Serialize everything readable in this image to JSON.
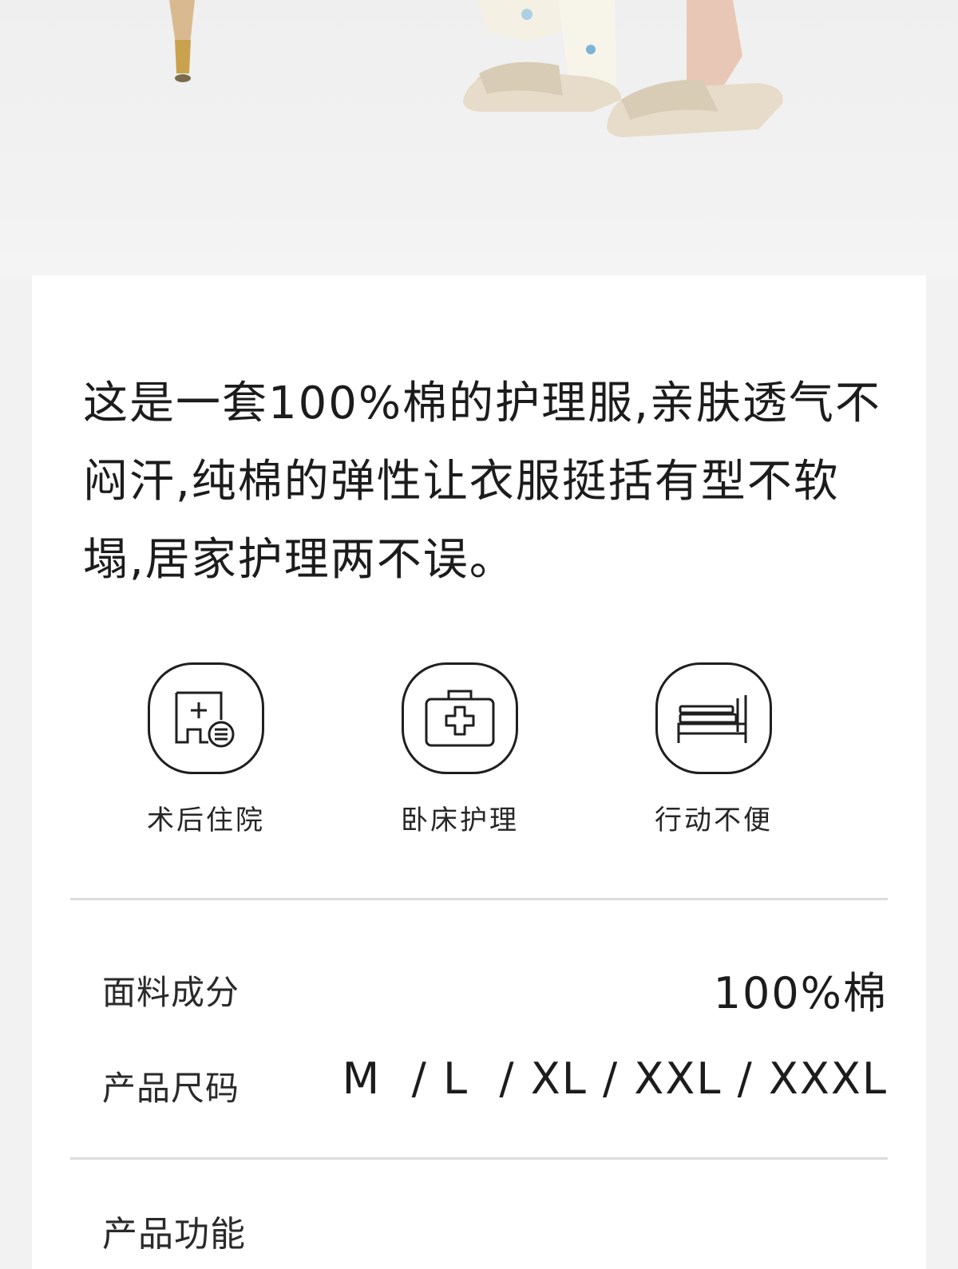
{
  "intro": {
    "text": "这是一套100%棉的护理服,亲肤透气不闷汗,纯棉的弹性让衣服挺括有型不软塌,居家护理两不误。"
  },
  "usages": [
    {
      "icon": "hospital-document-icon",
      "label": "术后住院"
    },
    {
      "icon": "medical-kit-icon",
      "label": "卧床护理"
    },
    {
      "icon": "bed-icon",
      "label": "行动不便"
    }
  ],
  "specs": {
    "fabric": {
      "label": "面料成分",
      "value": "100%棉"
    },
    "sizes": {
      "label": "产品尺码",
      "value": "M  / L  / XL / XXL / XXXL"
    }
  },
  "features": {
    "heading": "产品功能"
  },
  "colors": {
    "background": "#f2f2f2",
    "card": "#ffffff",
    "text": "#1f1f1f",
    "divider": "#dcdcdc"
  }
}
